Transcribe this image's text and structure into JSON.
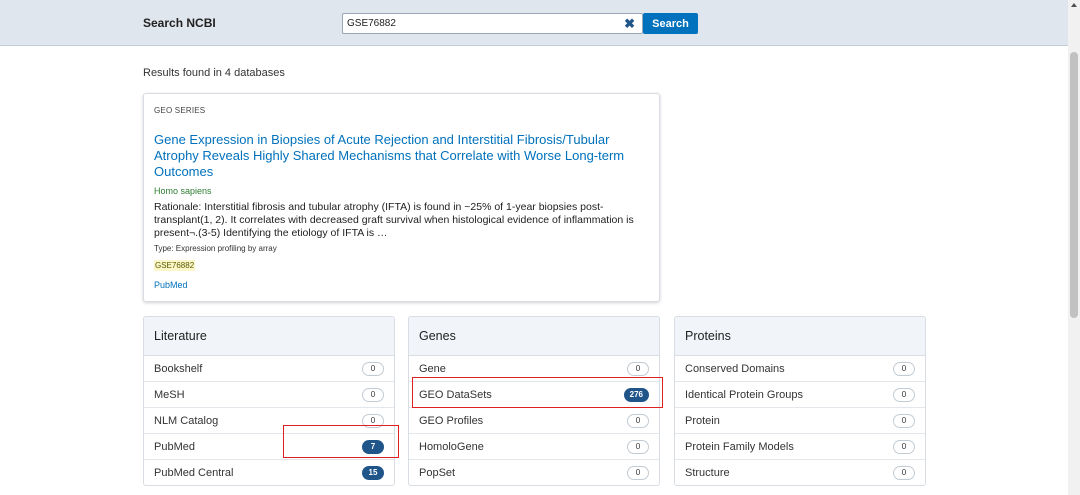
{
  "header": {
    "search_label": "Search NCBI",
    "search_value": "GSE76882",
    "clear_glyph": "✖",
    "search_button": "Search"
  },
  "results_summary": "Results found in 4 databases",
  "geo_card": {
    "db_label": "GEO SERIES",
    "title": "Gene Expression in Biopsies of Acute Rejection and Interstitial Fibrosis/Tubular Atrophy Reveals Highly Shared Mechanisms that Correlate with Worse Long-term Outcomes",
    "organism": "Homo sapiens",
    "summary": "Rationale: Interstitial fibrosis and tubular atrophy (IFTA) is found in ~25% of 1-year biopsies post-transplant(1, 2). It correlates with decreased graft survival when histological evidence of inflammation is present¬.(3-5) Identifying the etiology of IFTA is …",
    "type": "Type: Expression profiling by array",
    "accession": "GSE76882",
    "link": "PubMed"
  },
  "panels": {
    "literature": {
      "title": "Literature",
      "rows": [
        {
          "name": "Bookshelf",
          "count": "0"
        },
        {
          "name": "MeSH",
          "count": "0"
        },
        {
          "name": "NLM Catalog",
          "count": "0"
        },
        {
          "name": "PubMed",
          "count": "7"
        },
        {
          "name": "PubMed Central",
          "count": "15"
        }
      ]
    },
    "genes": {
      "title": "Genes",
      "rows": [
        {
          "name": "Gene",
          "count": "0"
        },
        {
          "name": "GEO DataSets",
          "count": "276"
        },
        {
          "name": "GEO Profiles",
          "count": "0"
        },
        {
          "name": "HomoloGene",
          "count": "0"
        },
        {
          "name": "PopSet",
          "count": "0"
        }
      ]
    },
    "proteins": {
      "title": "Proteins",
      "rows": [
        {
          "name": "Conserved Domains",
          "count": "0"
        },
        {
          "name": "Identical Protein Groups",
          "count": "0"
        },
        {
          "name": "Protein",
          "count": "0"
        },
        {
          "name": "Protein Family Models",
          "count": "0"
        },
        {
          "name": "Structure",
          "count": "0"
        }
      ]
    }
  },
  "colors": {
    "link": "#0071bc",
    "hit_badge": "#20558a",
    "annotation": "#e02020"
  }
}
